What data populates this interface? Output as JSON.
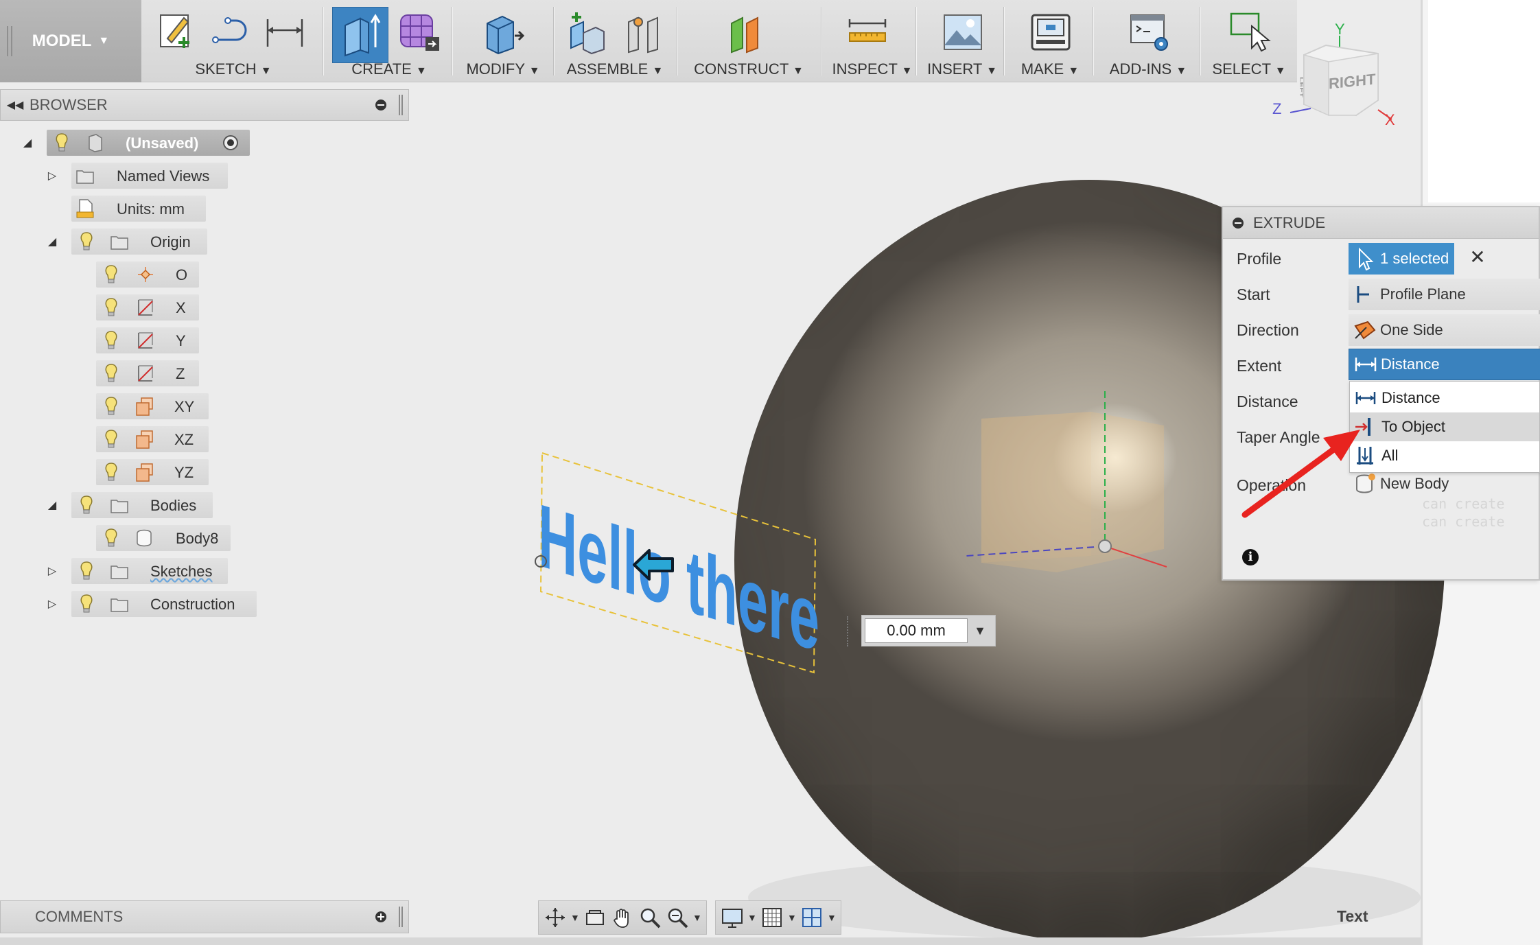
{
  "toolbar": {
    "workspace": "MODEL",
    "groups": [
      {
        "label": "SKETCH"
      },
      {
        "label": "CREATE"
      },
      {
        "label": "MODIFY"
      },
      {
        "label": "ASSEMBLE"
      },
      {
        "label": "CONSTRUCT"
      },
      {
        "label": "INSPECT"
      },
      {
        "label": "INSERT"
      },
      {
        "label": "MAKE"
      },
      {
        "label": "ADD-INS"
      },
      {
        "label": "SELECT"
      }
    ]
  },
  "viewcube": {
    "face": "RIGHT",
    "side": "LEFT",
    "axis_x": "X",
    "axis_y": "Y",
    "axis_z": "Z"
  },
  "browser": {
    "title": "BROWSER",
    "root": "(Unsaved)",
    "items": [
      {
        "label": "Named Views"
      },
      {
        "label": "Units: mm"
      },
      {
        "label": "Origin"
      },
      {
        "label": "O"
      },
      {
        "label": "X"
      },
      {
        "label": "Y"
      },
      {
        "label": "Z"
      },
      {
        "label": "XY"
      },
      {
        "label": "XZ"
      },
      {
        "label": "YZ"
      },
      {
        "label": "Bodies"
      },
      {
        "label": "Body8"
      },
      {
        "label": "Sketches"
      },
      {
        "label": "Construction"
      }
    ]
  },
  "canvas": {
    "sketch_text": "Hello there",
    "distance_value": "0.00 mm"
  },
  "extrude": {
    "title": "EXTRUDE",
    "rows": [
      {
        "label": "Profile",
        "value": "1 selected"
      },
      {
        "label": "Start",
        "value": "Profile Plane"
      },
      {
        "label": "Direction",
        "value": "One Side"
      },
      {
        "label": "Extent",
        "value": "Distance"
      },
      {
        "label": "Distance"
      },
      {
        "label": "Taper Angle"
      },
      {
        "label": "Operation",
        "value": "New Body"
      }
    ],
    "extent_options": [
      "Distance",
      "To Object",
      "All"
    ],
    "ghost_text_1": "can create",
    "ghost_text_2": "can create "
  },
  "comments": {
    "title": "COMMENTS"
  },
  "status": {
    "text_label": "Text"
  },
  "colors": {
    "accent_blue": "#3f8fcb",
    "sketch_text_blue": "#3d8fe0",
    "annotation_red": "#e8231f"
  }
}
